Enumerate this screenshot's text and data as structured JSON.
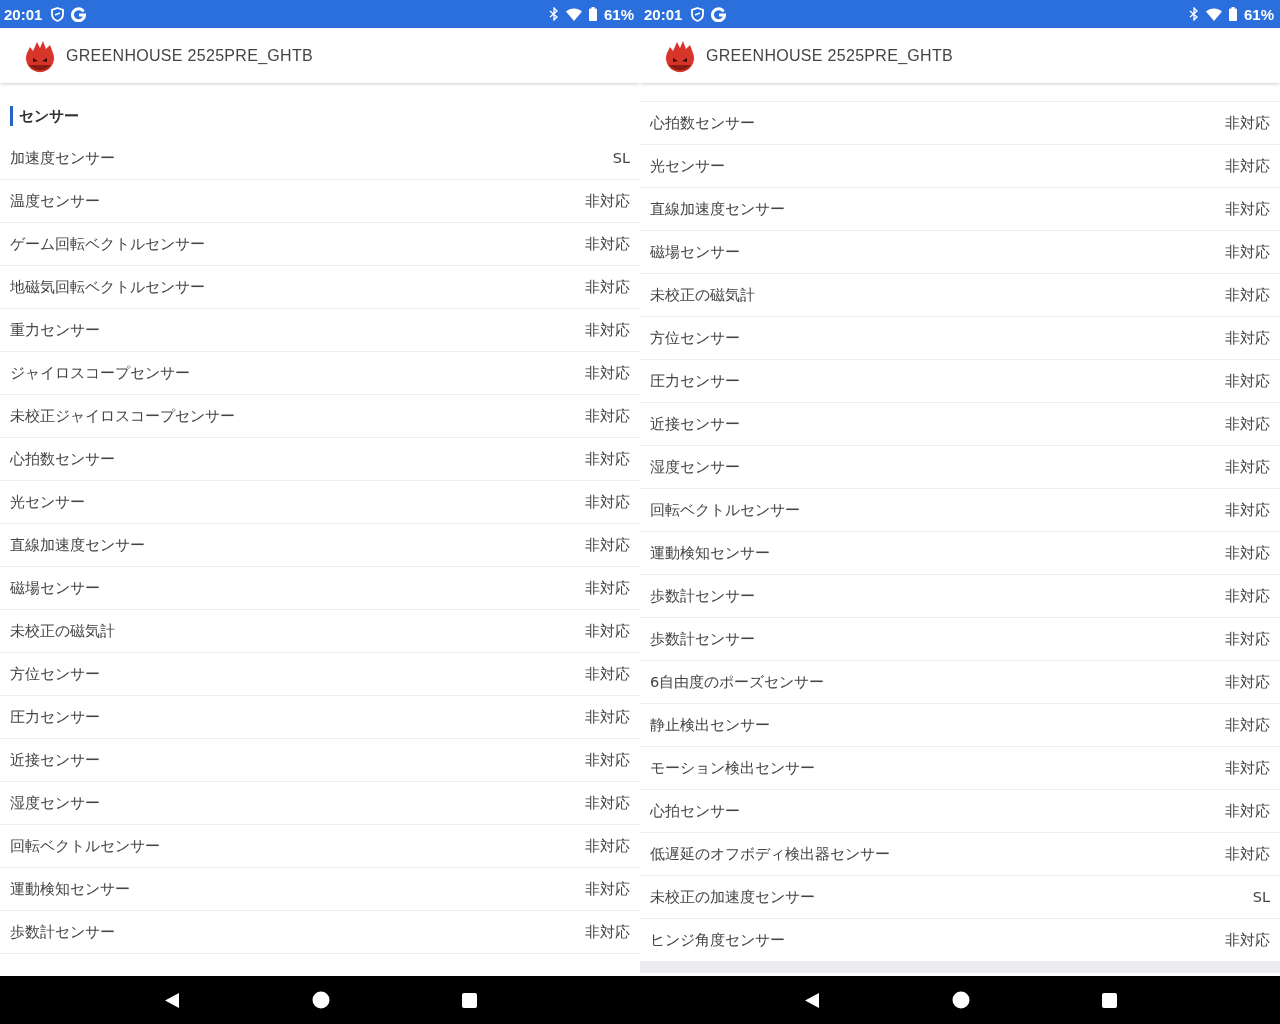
{
  "panels": [
    {
      "status_bar": {
        "time": "20:01",
        "battery": "61%"
      },
      "app_bar": {
        "title": "GREENHOUSE 2525PRE_GHTB"
      },
      "section_title": "センサー",
      "rows": [
        {
          "name": "加速度センサー",
          "value": "SL"
        },
        {
          "name": "温度センサー",
          "value": "非対応"
        },
        {
          "name": "ゲーム回転ベクトルセンサー",
          "value": "非対応"
        },
        {
          "name": "地磁気回転ベクトルセンサー",
          "value": "非対応"
        },
        {
          "name": "重力センサー",
          "value": "非対応"
        },
        {
          "name": "ジャイロスコープセンサー",
          "value": "非対応"
        },
        {
          "name": "未校正ジャイロスコープセンサー",
          "value": "非対応"
        },
        {
          "name": "心拍数センサー",
          "value": "非対応"
        },
        {
          "name": "光センサー",
          "value": "非対応"
        },
        {
          "name": "直線加速度センサー",
          "value": "非対応"
        },
        {
          "name": "磁場センサー",
          "value": "非対応"
        },
        {
          "name": "未校正の磁気計",
          "value": "非対応"
        },
        {
          "name": "方位センサー",
          "value": "非対応"
        },
        {
          "name": "圧力センサー",
          "value": "非対応"
        },
        {
          "name": "近接センサー",
          "value": "非対応"
        },
        {
          "name": "湿度センサー",
          "value": "非対応"
        },
        {
          "name": "回転ベクトルセンサー",
          "value": "非対応"
        },
        {
          "name": "運動検知センサー",
          "value": "非対応"
        },
        {
          "name": "歩数計センサー",
          "value": "非対応"
        }
      ]
    },
    {
      "status_bar": {
        "time": "20:01",
        "battery": "61%"
      },
      "app_bar": {
        "title": "GREENHOUSE 2525PRE_GHTB"
      },
      "rows": [
        {
          "name": "心拍数センサー",
          "value": "非対応"
        },
        {
          "name": "光センサー",
          "value": "非対応"
        },
        {
          "name": "直線加速度センサー",
          "value": "非対応"
        },
        {
          "name": "磁場センサー",
          "value": "非対応"
        },
        {
          "name": "未校正の磁気計",
          "value": "非対応"
        },
        {
          "name": "方位センサー",
          "value": "非対応"
        },
        {
          "name": "圧力センサー",
          "value": "非対応"
        },
        {
          "name": "近接センサー",
          "value": "非対応"
        },
        {
          "name": "湿度センサー",
          "value": "非対応"
        },
        {
          "name": "回転ベクトルセンサー",
          "value": "非対応"
        },
        {
          "name": "運動検知センサー",
          "value": "非対応"
        },
        {
          "name": "歩数計センサー",
          "value": "非対応"
        },
        {
          "name": "歩数計センサー",
          "value": "非対応"
        },
        {
          "name": "6自由度のポーズセンサー",
          "value": "非対応"
        },
        {
          "name": "静止検出センサー",
          "value": "非対応"
        },
        {
          "name": "モーション検出センサー",
          "value": "非対応"
        },
        {
          "name": "心拍センサー",
          "value": "非対応"
        },
        {
          "name": "低遅延のオフボディ検出器センサー",
          "value": "非対応"
        },
        {
          "name": "未校正の加速度センサー",
          "value": "SL"
        },
        {
          "name": "ヒンジ角度センサー",
          "value": "非対応"
        }
      ]
    }
  ]
}
